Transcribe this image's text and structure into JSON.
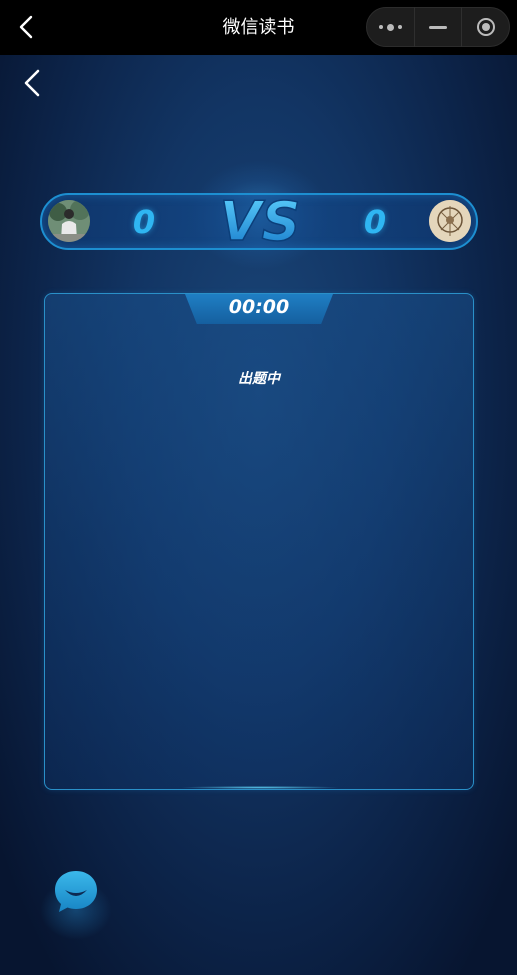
{
  "window": {
    "title": "微信读书",
    "back_icon": "chevron-left-icon",
    "capsule": {
      "more_icon": "more-dots-icon",
      "minimize_icon": "minimize-icon",
      "close_icon": "target-circle-icon"
    }
  },
  "page": {
    "back_icon": "chevron-left-icon",
    "match": {
      "left_score": "0",
      "right_score": "0",
      "vs_label": "VS"
    },
    "panel": {
      "timer": "00:00",
      "status": "出题中"
    },
    "chat_icon": "chat-bubble-icon"
  },
  "colors": {
    "accent": "#2fb6f2",
    "panel_border": "#2a90c8",
    "background": "#0c2348"
  }
}
